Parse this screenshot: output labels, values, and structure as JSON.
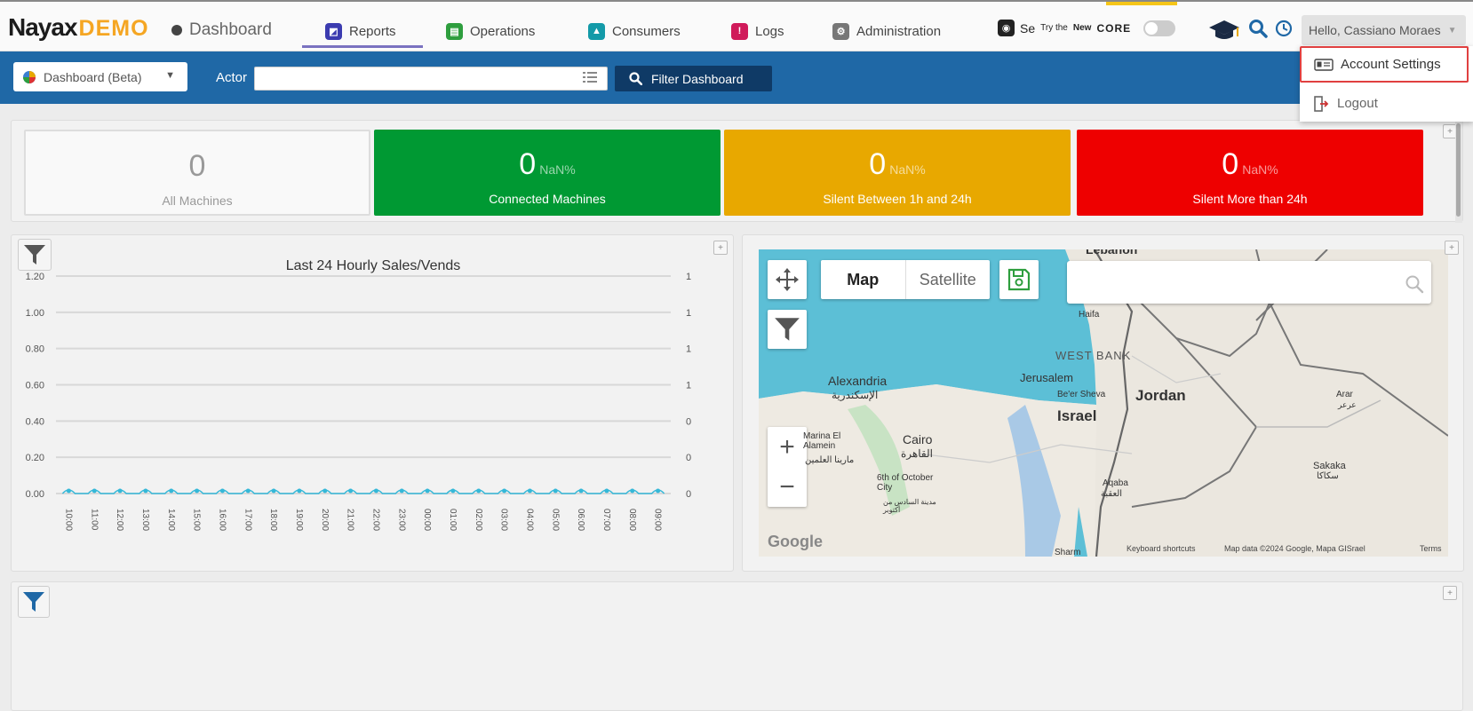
{
  "header": {
    "logo_main": "Nayax",
    "logo_demo": "DEMO",
    "page_name": "Dashboard",
    "nav": [
      {
        "label": "Reports",
        "color": "#3b3bb0"
      },
      {
        "label": "Operations",
        "color": "#2e9e3e"
      },
      {
        "label": "Consumers",
        "color": "#139aa8"
      },
      {
        "label": "Logs",
        "color": "#d01a5a"
      },
      {
        "label": "Administration",
        "color": "#777777"
      }
    ],
    "try_core": {
      "prefix": "Se",
      "small": "Try the",
      "new_label": "New",
      "core": "CORE"
    },
    "user_greeting": "Hello, Cassiano Moraes"
  },
  "user_dropdown": {
    "account_settings": "Account Settings",
    "logout": "Logout"
  },
  "toolbar": {
    "dashboard_select": "Dashboard (Beta)",
    "actor_label": "Actor",
    "actor_value": "",
    "filter_button": "Filter Dashboard"
  },
  "stats": [
    {
      "value": "0",
      "pct": "",
      "label": "All Machines"
    },
    {
      "value": "0",
      "pct": "NaN%",
      "label": "Connected Machines"
    },
    {
      "value": "0",
      "pct": "NaN%",
      "label": "Silent Between 1h and 24h"
    },
    {
      "value": "0",
      "pct": "NaN%",
      "label": "Silent More than 24h"
    }
  ],
  "colors": {
    "toolbar_blue": "#1f68a6",
    "connected_green": "#009933",
    "silent_mid_orange": "#e8a800",
    "silent_red": "#ee0000",
    "highlight_red": "#e04040"
  },
  "map": {
    "toggle_map": "Map",
    "toggle_satellite": "Satellite",
    "search_value": "",
    "labels": {
      "lebanon": "Lebanon",
      "haifa": "Haifa",
      "west_bank": "WEST BANK",
      "alexandria": "Alexandria",
      "alexandria_ar": "الإسكندرية",
      "jerusalem": "Jerusalem",
      "beer_sheva": "Be'er Sheva",
      "israel": "Israel",
      "jordan": "Jordan",
      "arar": "Arar",
      "arar_ar": "عرعر",
      "el_alamein": "Marina El Alamein",
      "el_alamein_ar": "مارينا العلمين",
      "cairo": "Cairo",
      "cairo_ar": "القاهرة",
      "october": "6th of October City",
      "october_ar": "مدينة السادس من أكتوبر",
      "aqaba": "Aqaba",
      "aqaba_ar": "العقبة",
      "sakaka": "Sakaka",
      "sakaka_ar": "سكاكا",
      "sharm": "Sharm"
    },
    "google": "Google",
    "footer": {
      "shortcuts": "Keyboard shortcuts",
      "map_data": "Map data ©2024 Google, Mapa GISrael",
      "terms": "Terms"
    }
  },
  "chart_data": {
    "type": "line",
    "title": "Last 24 Hourly Sales/Vends",
    "categories": [
      "10:00",
      "11:00",
      "12:00",
      "13:00",
      "14:00",
      "15:00",
      "16:00",
      "17:00",
      "18:00",
      "19:00",
      "20:00",
      "21:00",
      "22:00",
      "23:00",
      "00:00",
      "01:00",
      "02:00",
      "03:00",
      "04:00",
      "05:00",
      "06:00",
      "07:00",
      "08:00",
      "09:00"
    ],
    "series": [
      {
        "values": [
          0,
          0,
          0,
          0,
          0,
          0,
          0,
          0,
          0,
          0,
          0,
          0,
          0,
          0,
          0,
          0,
          0,
          0,
          0,
          0,
          0,
          0,
          0,
          0
        ]
      }
    ],
    "ylim": [
      0,
      1.2
    ],
    "y_ticks": [
      "0.00",
      "0.20",
      "0.40",
      "0.60",
      "0.80",
      "1.00",
      "1.20"
    ],
    "y2_ticks": [
      "0",
      "0",
      "0",
      "1",
      "1",
      "1",
      "1"
    ],
    "grid": true,
    "color": "#35b8d8"
  }
}
